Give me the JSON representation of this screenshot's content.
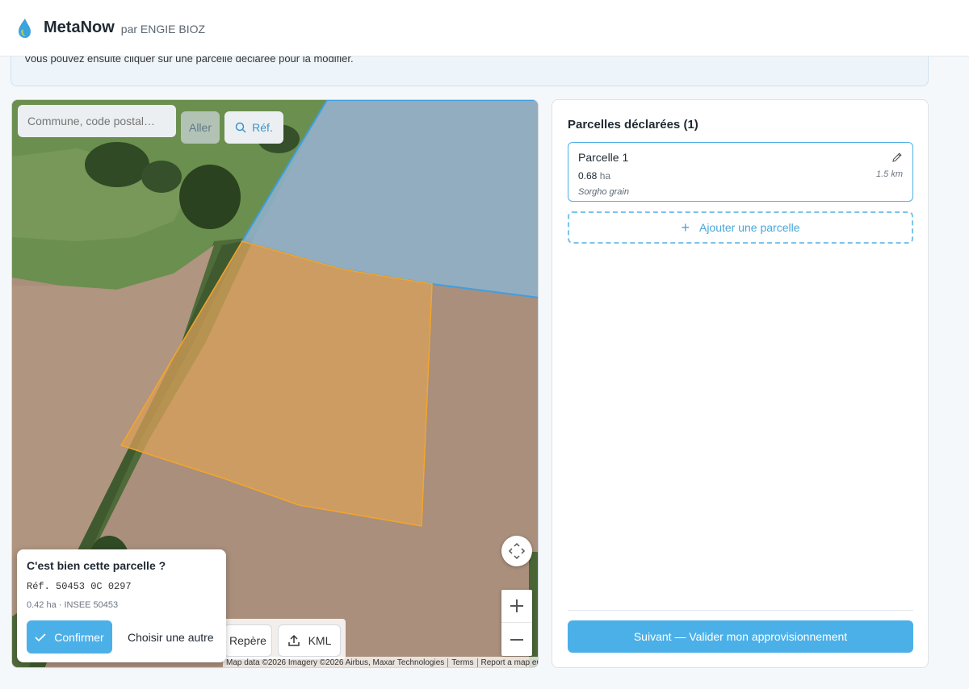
{
  "header": {
    "brand": "MetaNow",
    "brand_sub": "par ENGIE BIOZ"
  },
  "info": {
    "text": "Vous pouvez ensuite cliquer sur une parcelle déclarée pour la modifier."
  },
  "map": {
    "search_placeholder": "Commune, code postal…",
    "go_label": "Aller",
    "ref_label": "Réf.",
    "landmark_label": "Repère",
    "kml_label": "KML",
    "attribution": {
      "data": "Map data ©2026 Imagery ©2026 Airbus, Maxar Technologies",
      "terms": "Terms",
      "report": "Report a map error"
    },
    "icons": {
      "search": "search-icon",
      "recenter": "recenter-icon",
      "zoom_in": "plus-icon",
      "zoom_out": "minus-icon",
      "upload": "upload-icon"
    }
  },
  "confirm_card": {
    "title": "C'est bien cette parcelle ?",
    "ref": "Réf. 50453 0C 0297",
    "meta": "0.42 ha · INSEE 50453",
    "confirm_label": "Confirmer",
    "other_label": "Choisir une autre"
  },
  "panel": {
    "title": "Parcelles déclarées (1)",
    "parcels": [
      {
        "name": "Parcelle 1",
        "area": "0.68",
        "area_unit": "ha",
        "distance": "1.5 km",
        "crop": "Sorgho grain"
      }
    ],
    "add_label": "Ajouter une parcelle",
    "next_label": "Suivant — Valider mon approvisionnement"
  },
  "colors": {
    "accent": "#4cb0e8",
    "declared_parcel_fill": "#8fb8d8",
    "selected_parcel_fill": "#e8a24a",
    "selected_parcel_stroke": "#f4a52a"
  }
}
